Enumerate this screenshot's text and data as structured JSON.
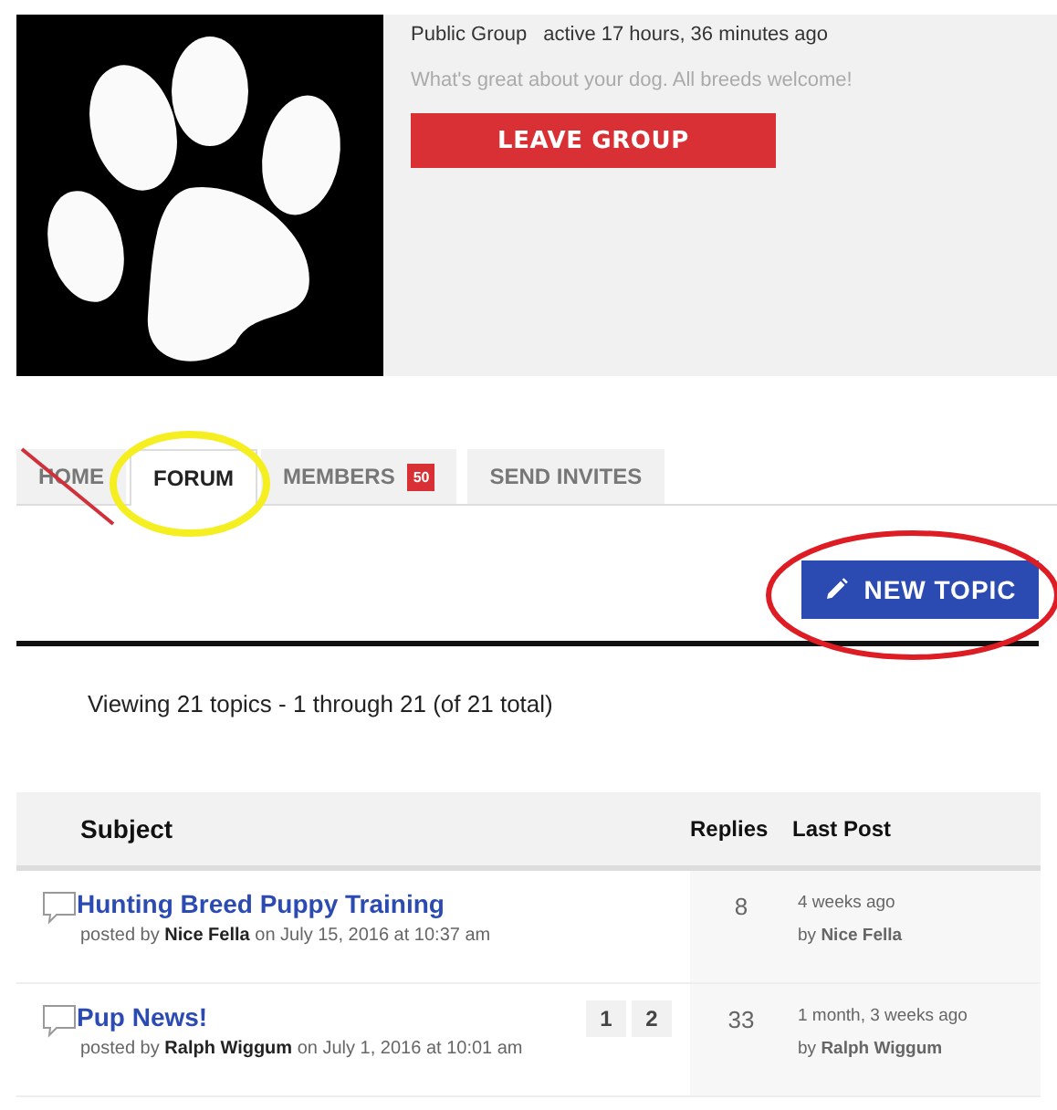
{
  "group": {
    "privacy": "Public Group",
    "activity": "active 17 hours, 36 minutes ago",
    "description": "What's great about your dog. All breeds welcome!",
    "button": "LEAVE GROUP"
  },
  "tabs": [
    {
      "label": "HOME",
      "selected": false
    },
    {
      "label": "FORUM",
      "selected": true
    },
    {
      "label": "MEMBERS",
      "selected": false,
      "count": "50"
    },
    {
      "label": "SEND INVITES",
      "selected": false
    }
  ],
  "new_topic_button": "NEW TOPIC",
  "pagination_info": "Viewing 21 topics - 1 through 21 (of 21 total)",
  "table": {
    "columns": [
      "Subject",
      "Replies",
      "Last Post"
    ],
    "rows": [
      {
        "title": "Hunting Breed Puppy Training",
        "posted_prefix": "posted by",
        "author": "Nice Fella",
        "posted_date": "on July 15, 2016 at 10:37 am",
        "pages": [],
        "replies": "8",
        "last_post": "4 weeks ago",
        "last_by": "by",
        "last_author": "Nice Fella"
      },
      {
        "title": "Pup News!",
        "posted_prefix": "posted by",
        "author": "Ralph Wiggum",
        "posted_date": "on July 1, 2016 at 10:01 am",
        "pages": [
          "1",
          "2"
        ],
        "replies": "33",
        "last_post": "1 month, 3 weeks ago",
        "last_by": "by",
        "last_author": "Ralph Wiggum"
      }
    ]
  }
}
